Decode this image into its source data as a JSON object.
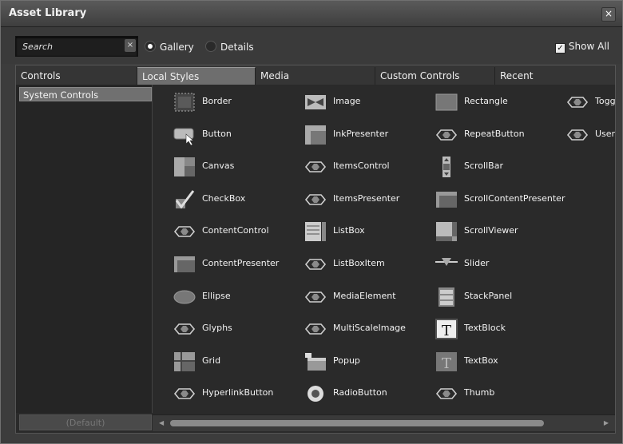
{
  "window": {
    "title": "Asset Library",
    "close_glyph": "×"
  },
  "search": {
    "placeholder": "Search",
    "clear_glyph": "×"
  },
  "view_mode": {
    "options": [
      "Gallery",
      "Details"
    ],
    "selected": "Gallery"
  },
  "show_all": {
    "label": "Show All",
    "checked": true,
    "check_glyph": "✓"
  },
  "tabs": [
    {
      "label": "Controls",
      "selected": false
    },
    {
      "label": "Local Styles",
      "selected": true
    },
    {
      "label": "Media",
      "selected": false
    },
    {
      "label": "Custom Controls",
      "selected": false
    },
    {
      "label": "Recent",
      "selected": false
    }
  ],
  "sidebar": {
    "items": [
      "System Controls"
    ],
    "default_button": "(Default)"
  },
  "assets": {
    "columns": [
      [
        {
          "label": "Border",
          "icon": "border-icon"
        },
        {
          "label": "Button",
          "icon": "button-icon"
        },
        {
          "label": "Canvas",
          "icon": "canvas-icon"
        },
        {
          "label": "CheckBox",
          "icon": "checkbox-icon"
        },
        {
          "label": "ContentControl",
          "icon": "generic-control-icon"
        },
        {
          "label": "ContentPresenter",
          "icon": "content-presenter-icon"
        },
        {
          "label": "Ellipse",
          "icon": "ellipse-icon"
        },
        {
          "label": "Glyphs",
          "icon": "generic-control-icon"
        },
        {
          "label": "Grid",
          "icon": "grid-icon"
        },
        {
          "label": "HyperlinkButton",
          "icon": "generic-control-icon"
        }
      ],
      [
        {
          "label": "Image",
          "icon": "image-icon"
        },
        {
          "label": "InkPresenter",
          "icon": "ink-presenter-icon"
        },
        {
          "label": "ItemsControl",
          "icon": "generic-control-icon"
        },
        {
          "label": "ItemsPresenter",
          "icon": "generic-control-icon"
        },
        {
          "label": "ListBox",
          "icon": "listbox-icon"
        },
        {
          "label": "ListBoxItem",
          "icon": "generic-control-icon"
        },
        {
          "label": "MediaElement",
          "icon": "generic-control-icon"
        },
        {
          "label": "MultiScaleImage",
          "icon": "generic-control-icon"
        },
        {
          "label": "Popup",
          "icon": "popup-icon"
        },
        {
          "label": "RadioButton",
          "icon": "radiobutton-icon"
        }
      ],
      [
        {
          "label": "Rectangle",
          "icon": "rectangle-icon"
        },
        {
          "label": "RepeatButton",
          "icon": "generic-control-icon"
        },
        {
          "label": "ScrollBar",
          "icon": "scrollbar-icon"
        },
        {
          "label": "ScrollContentPresenter",
          "icon": "content-presenter-icon"
        },
        {
          "label": "ScrollViewer",
          "icon": "scrollviewer-icon"
        },
        {
          "label": "Slider",
          "icon": "slider-icon"
        },
        {
          "label": "StackPanel",
          "icon": "stackpanel-icon"
        },
        {
          "label": "TextBlock",
          "icon": "textblock-icon"
        },
        {
          "label": "TextBox",
          "icon": "textbox-icon"
        },
        {
          "label": "Thumb",
          "icon": "generic-control-icon"
        }
      ],
      [
        {
          "label": "ToggleBu",
          "icon": "generic-control-icon"
        },
        {
          "label": "UserCon",
          "icon": "generic-control-icon"
        }
      ]
    ]
  },
  "scrollbar": {
    "left_glyph": "◀",
    "right_glyph": "▶"
  }
}
